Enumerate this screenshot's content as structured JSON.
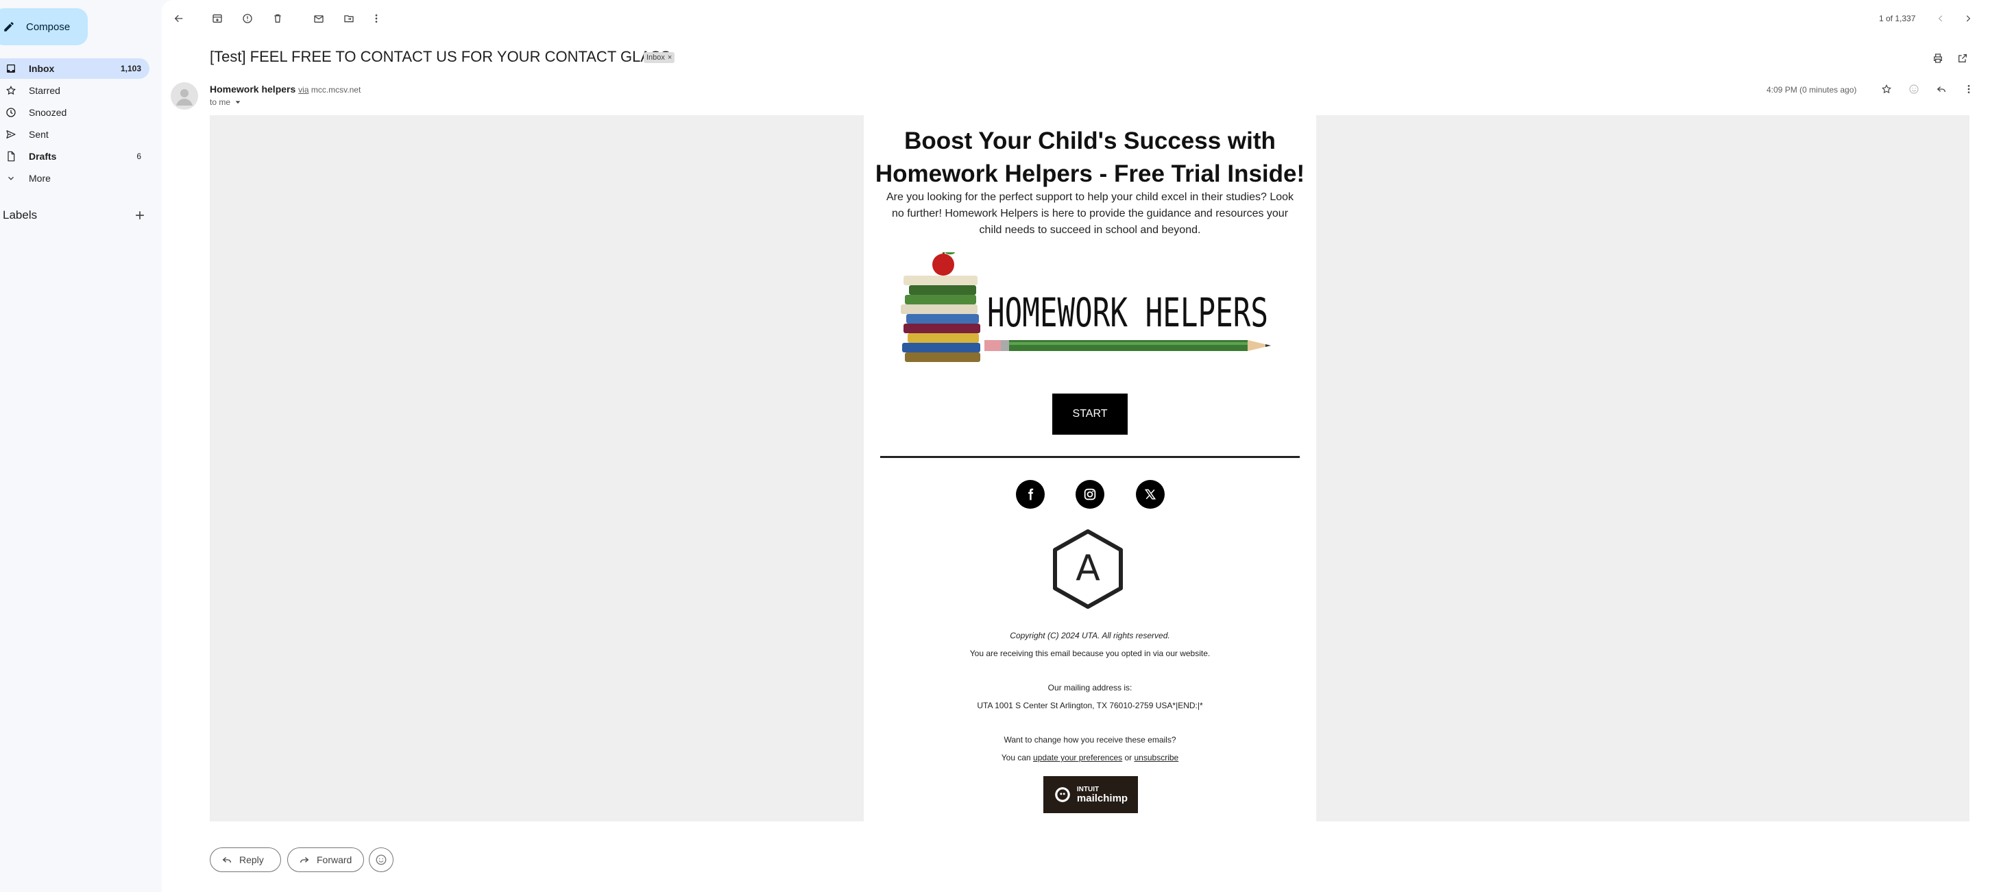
{
  "sidebar": {
    "compose_label": "Compose",
    "items": [
      {
        "label": "Inbox",
        "count": "1,103"
      },
      {
        "label": "Starred",
        "count": ""
      },
      {
        "label": "Snoozed",
        "count": ""
      },
      {
        "label": "Sent",
        "count": ""
      },
      {
        "label": "Drafts",
        "count": "6"
      },
      {
        "label": "More",
        "count": ""
      }
    ],
    "labels_heading": "Labels"
  },
  "toolbar": {
    "icons": [
      "back-arrow-icon",
      "archive-icon",
      "report-spam-icon",
      "delete-icon",
      "mark-unread-icon",
      "move-to-icon",
      "more-vert-icon"
    ],
    "pager": "1 of 1,337"
  },
  "message": {
    "subject": "[Test] FEEL FREE TO CONTACT US FOR YOUR CONTACT GLASS",
    "label_chip": "Inbox",
    "sender_name": "Homework helpers",
    "via_text": "via",
    "via_domain": "mcc.mcsv.net",
    "to_text": "to me",
    "time": "4:09 PM (0 minutes ago)"
  },
  "email": {
    "headline": "Boost Your Child's Success with Homework Helpers - Free Trial Inside!",
    "intro": "Are you looking for the perfect support to help your child excel in their studies? Look no further! Homework Helpers is here to provide the guidance and resources your child needs to succeed in school and beyond.",
    "logo_text": "HOMEWORK HELPERS",
    "start_label": "START",
    "badge_letter": "A",
    "copyright": "Copyright (C) 2024 UTA. All rights reserved.",
    "opted_in": "You are receiving this email because you opted in via our website.",
    "mailing_heading": "Our mailing address is:",
    "address": "UTA 1001 S Center St Arlington, TX 76010-2759 USA*|END:|*",
    "change_prompt": "Want to change how you receive these emails?",
    "you_can": "You can",
    "update_link": "update your preferences",
    "or_text": "or",
    "unsubscribe_link": "unsubscribe",
    "mailchimp_line1": "INTUIT",
    "mailchimp_line2": "mailchimp"
  },
  "reply_bar": {
    "reply_label": "Reply",
    "forward_label": "Forward"
  },
  "colors": {
    "compose_bg": "#c2e7ff",
    "active_nav_bg": "#d3e3fd",
    "page_bg": "#f6f8fc"
  }
}
